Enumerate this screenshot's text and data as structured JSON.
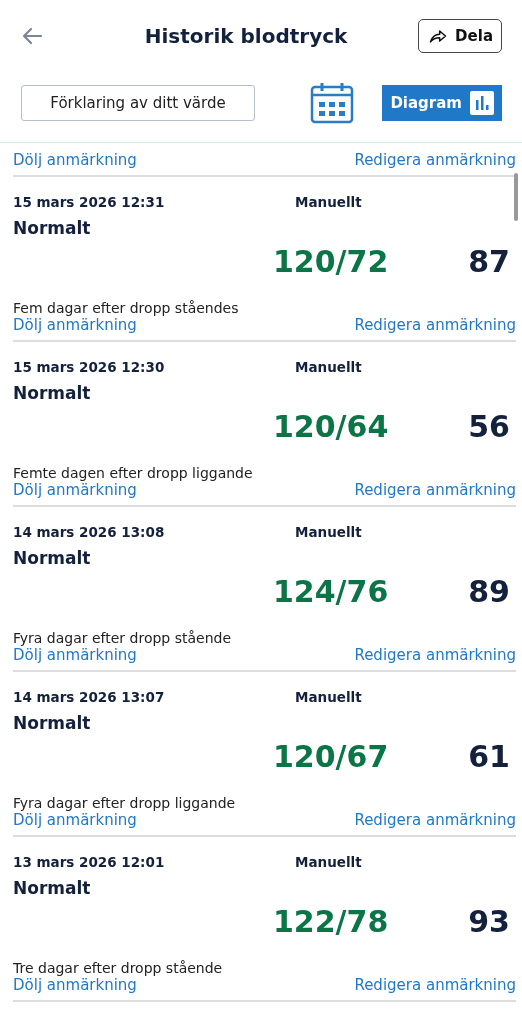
{
  "header": {
    "title": "Historik blodtryck",
    "share_label": "Dela"
  },
  "toolbar": {
    "explain_label": "Förklaring av ditt värde",
    "diagram_label": "Diagram"
  },
  "partial_entry": {
    "hide_note_label": "Dölj anmärkning",
    "edit_note_label": "Redigera anmärkning"
  },
  "entries": [
    {
      "datetime": "15 mars 2026 12:31",
      "source": "Manuellt",
      "status": "Normalt",
      "color": "#0b7548",
      "pressure": "120/72",
      "pulse": "87",
      "note": "Fem dagar efter dropp ståendes",
      "hide_note_label": "Dölj anmärkning",
      "edit_note_label": "Redigera anmärkning"
    },
    {
      "datetime": "15 mars 2026 12:30",
      "source": "Manuellt",
      "status": "Normalt",
      "color": "#0b7548",
      "pressure": "120/64",
      "pulse": "56",
      "note": "Femte dagen efter dropp liggande",
      "hide_note_label": "Dölj anmärkning",
      "edit_note_label": "Redigera anmärkning"
    },
    {
      "datetime": "14 mars 2026 13:08",
      "source": "Manuellt",
      "status": "Normalt",
      "color": "#0b7548",
      "pressure": "124/76",
      "pulse": "89",
      "note": "Fyra dagar efter dropp stående",
      "hide_note_label": "Dölj anmärkning",
      "edit_note_label": "Redigera anmärkning"
    },
    {
      "datetime": "14 mars 2026 13:07",
      "source": "Manuellt",
      "status": "Normalt",
      "color": "#0b7548",
      "pressure": "120/67",
      "pulse": "61",
      "note": "Fyra dagar efter dropp liggande",
      "hide_note_label": "Dölj anmärkning",
      "edit_note_label": "Redigera anmärkning"
    },
    {
      "datetime": "13 mars 2026 12:01",
      "source": "Manuellt",
      "status": "Normalt",
      "color": "#0b7548",
      "pressure": "122/78",
      "pulse": "93",
      "note": "Tre dagar efter dropp stående",
      "hide_note_label": "Dölj anmärkning",
      "edit_note_label": "Redigera anmärkning"
    }
  ]
}
